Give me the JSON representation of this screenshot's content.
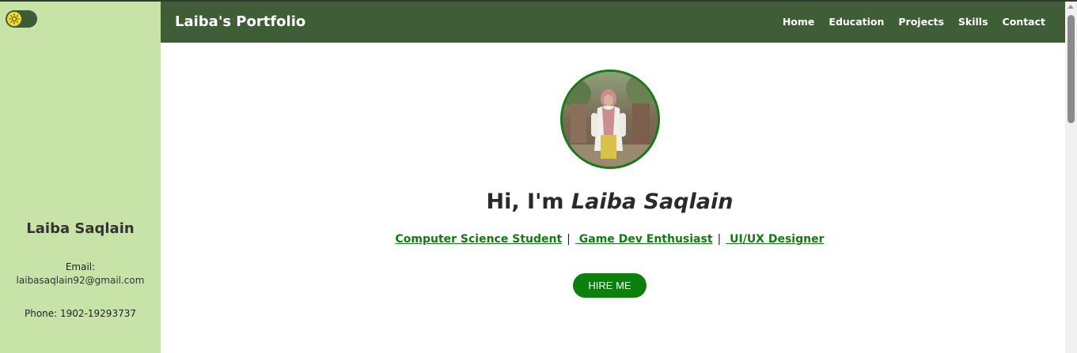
{
  "sidebar": {
    "theme_toggle_icon": "sun-icon",
    "name": "Laiba Saqlain",
    "email_label": "Email:",
    "email": "laibasaqlain92@gmail.com",
    "phone": "Phone: 1902-19293737"
  },
  "navbar": {
    "brand": "Laiba's Portfolio",
    "links": [
      "Home",
      "Education",
      "Projects",
      "Skills",
      "Contact"
    ]
  },
  "hero": {
    "greeting": "Hi, I'm ",
    "name": "Laiba Saqlain",
    "roles": [
      "Computer Science Student",
      " Game Dev Enthusiast",
      " UI/UX Designer"
    ],
    "separator": "|",
    "button_label": "HIRE ME"
  },
  "colors": {
    "sidebar_bg": "#c8e3a8",
    "navbar_bg": "#3f5e38",
    "accent_green": "#0d7f0d",
    "toggle_knob": "#f2dc2a"
  }
}
